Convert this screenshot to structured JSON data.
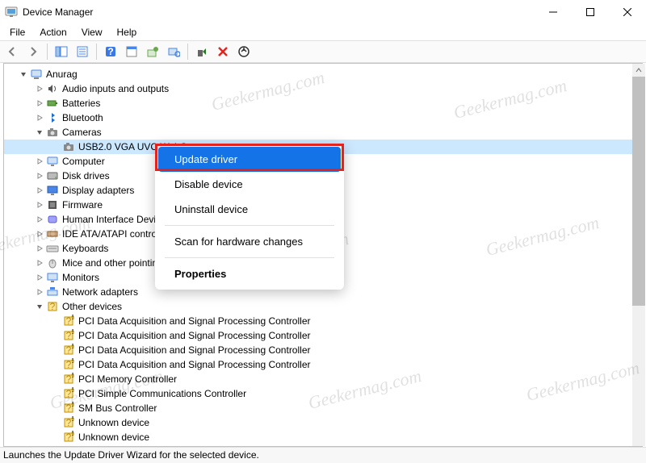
{
  "window": {
    "title": "Device Manager"
  },
  "menubar": {
    "items": [
      "File",
      "Action",
      "View",
      "Help"
    ]
  },
  "toolbar": {
    "buttons": [
      {
        "name": "back"
      },
      {
        "name": "forward"
      },
      {
        "name": "show-hide-console-tree"
      },
      {
        "name": "details"
      },
      {
        "name": "help"
      },
      {
        "name": "properties"
      },
      {
        "name": "update-driver"
      },
      {
        "name": "scan-hardware"
      },
      {
        "name": "uninstall-device"
      },
      {
        "name": "disable-device"
      },
      {
        "name": "add-legacy-hardware"
      }
    ]
  },
  "tree": {
    "root": "Anurag",
    "categories": [
      {
        "label": "Audio inputs and outputs",
        "icon": "speaker",
        "expanded": false
      },
      {
        "label": "Batteries",
        "icon": "battery",
        "expanded": false
      },
      {
        "label": "Bluetooth",
        "icon": "bluetooth",
        "expanded": false
      },
      {
        "label": "Cameras",
        "icon": "camera",
        "expanded": true,
        "children": [
          {
            "label": "USB2.0 VGA UVC WebCam",
            "icon": "camera",
            "selected": true
          }
        ]
      },
      {
        "label": "Computer",
        "icon": "computer",
        "expanded": false
      },
      {
        "label": "Disk drives",
        "icon": "disk",
        "expanded": false
      },
      {
        "label": "Display adapters",
        "icon": "display",
        "expanded": false
      },
      {
        "label": "Firmware",
        "icon": "firmware",
        "expanded": false
      },
      {
        "label": "Human Interface Devices",
        "icon": "hid",
        "expanded": false
      },
      {
        "label": "IDE ATA/ATAPI controllers",
        "icon": "ide",
        "expanded": false
      },
      {
        "label": "Keyboards",
        "icon": "keyboard",
        "expanded": false
      },
      {
        "label": "Mice and other pointing devices",
        "icon": "mouse",
        "expanded": false
      },
      {
        "label": "Monitors",
        "icon": "monitor",
        "expanded": false
      },
      {
        "label": "Network adapters",
        "icon": "network",
        "expanded": false
      },
      {
        "label": "Other devices",
        "icon": "other",
        "expanded": true,
        "children": [
          {
            "label": "PCI Data Acquisition and Signal Processing Controller",
            "icon": "warning"
          },
          {
            "label": "PCI Data Acquisition and Signal Processing Controller",
            "icon": "warning"
          },
          {
            "label": "PCI Data Acquisition and Signal Processing Controller",
            "icon": "warning"
          },
          {
            "label": "PCI Data Acquisition and Signal Processing Controller",
            "icon": "warning"
          },
          {
            "label": "PCI Memory Controller",
            "icon": "warning"
          },
          {
            "label": "PCI Simple Communications Controller",
            "icon": "warning"
          },
          {
            "label": "SM Bus Controller",
            "icon": "warning"
          },
          {
            "label": "Unknown device",
            "icon": "warning"
          },
          {
            "label": "Unknown device",
            "icon": "warning"
          }
        ]
      }
    ]
  },
  "context_menu": {
    "items": [
      {
        "label": "Update driver",
        "selected": true
      },
      {
        "label": "Disable device"
      },
      {
        "label": "Uninstall device"
      },
      {
        "separator": true
      },
      {
        "label": "Scan for hardware changes"
      },
      {
        "separator": true
      },
      {
        "label": "Properties",
        "bold": true
      }
    ]
  },
  "statusbar": {
    "text": "Launches the Update Driver Wizard for the selected device."
  },
  "watermark": {
    "text": "Geekermag.com"
  }
}
